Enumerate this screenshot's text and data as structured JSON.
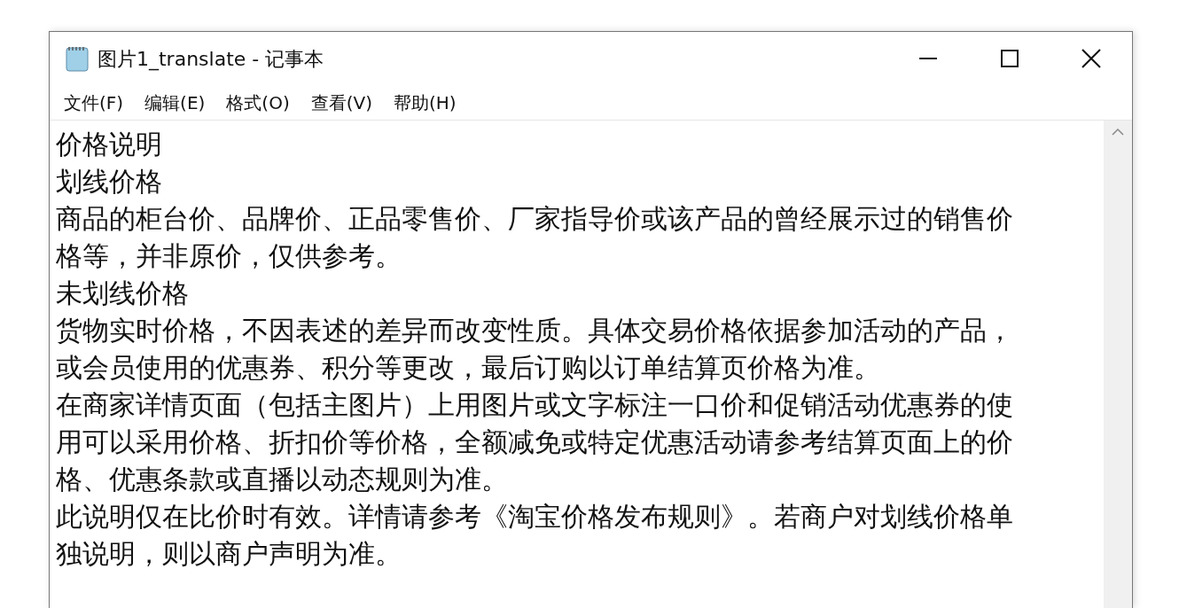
{
  "window": {
    "title": "图片1_translate - 记事本"
  },
  "menu": [
    "文件(F)",
    "编辑(E)",
    "格式(O)",
    "查看(V)",
    "帮助(H)"
  ],
  "editor": {
    "lines": [
      "价格说明",
      "划线价格",
      "商品的柜台价、品牌价、正品零售价、厂家指导价或该产品的曾经展示过的销售价",
      "格等，并非原价，仅供参考。",
      "未划线价格",
      "货物实时价格，不因表述的差异而改变性质。具体交易价格依据参加活动的产品，",
      "或会员使用的优惠券、积分等更改，最后订购以订单结算页价格为准。",
      "在商家详情页面（包括主图片）上用图片或文字标注一口价和促销活动优惠券的使",
      "用可以采用价格、折扣价等价格，全额减免或特定优惠活动请参考结算页面上的价",
      "格、优惠条款或直播以动态规则为准。",
      "此说明仅在比价时有效。详情请参考《淘宝价格发布规则》。若商户对划线价格单",
      "独说明，则以商户声明为准。"
    ]
  }
}
